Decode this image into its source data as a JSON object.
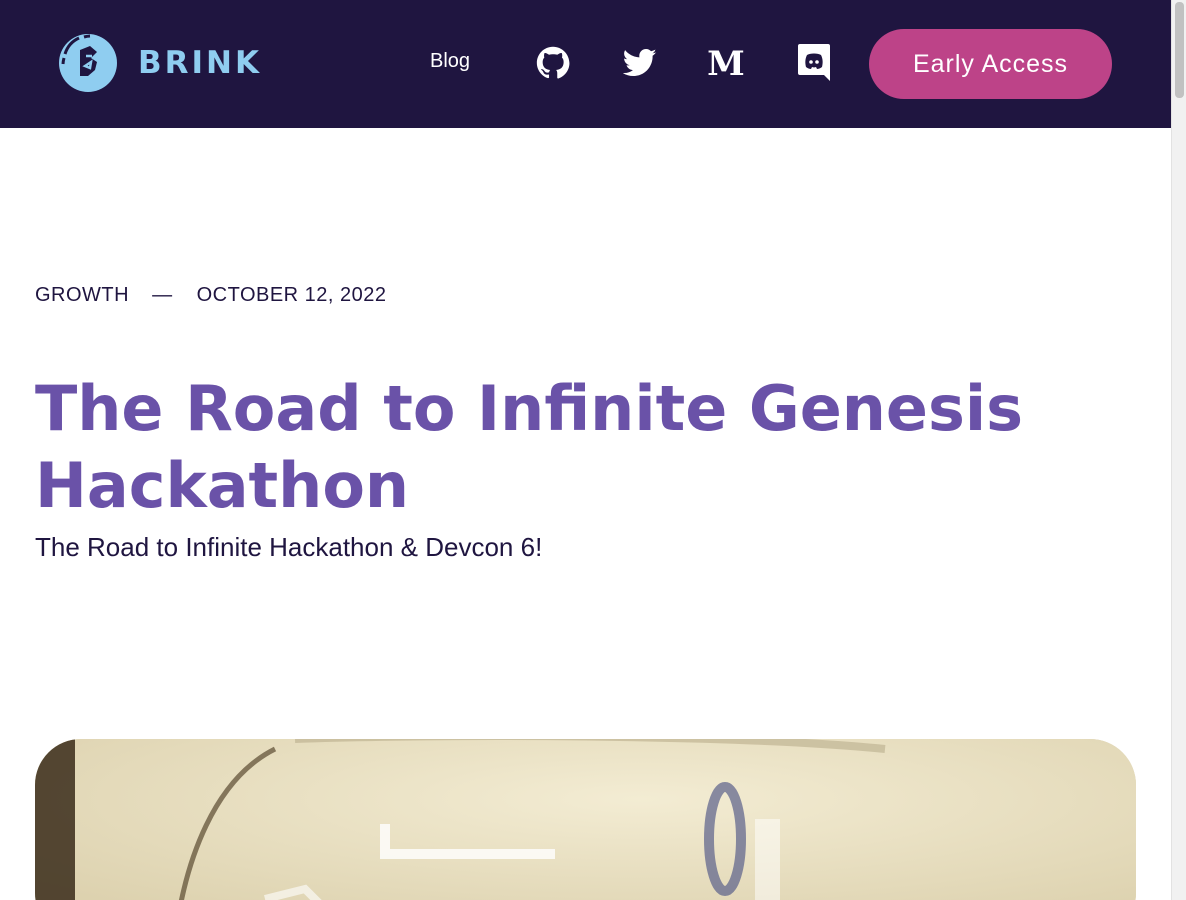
{
  "header": {
    "brand": "BRINK",
    "nav_blog": "Blog",
    "icons": [
      "github-icon",
      "twitter-icon",
      "medium-icon",
      "discord-icon"
    ],
    "cta_label": "Early Access"
  },
  "article": {
    "category": "GROWTH",
    "separator": "—",
    "date": "OCTOBER 12, 2022",
    "title": "The Road to Infinite Genesis Hackathon",
    "subtitle": "The Road to Infinite Hackathon & Devcon 6!"
  },
  "colors": {
    "header_bg": "#1f1540",
    "brand_text": "#8fcdf0",
    "cta_bg": "#bd4388",
    "title": "#6a52a8",
    "body_text": "#1f1540"
  }
}
